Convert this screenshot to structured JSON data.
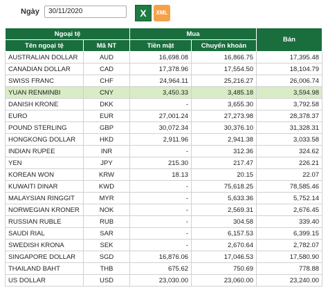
{
  "filter": {
    "date_label": "Ngày",
    "date_value": "30/11/2020",
    "excel_label": "X",
    "xml_label": "XML"
  },
  "table": {
    "group_headers": {
      "currency": "Ngoại tệ",
      "buy": "Mua",
      "sell": "Bán"
    },
    "sub_headers": {
      "name": "Tên ngoại tệ",
      "code": "Mã NT",
      "cash": "Tiền mặt",
      "transfer": "Chuyển khoản"
    },
    "rows": [
      {
        "name": "AUSTRALIAN DOLLAR",
        "code": "AUD",
        "cash": "16,698.08",
        "transfer": "16,866.75",
        "sell": "17,395.48"
      },
      {
        "name": "CANADIAN DOLLAR",
        "code": "CAD",
        "cash": "17,378.96",
        "transfer": "17,554.50",
        "sell": "18,104.79"
      },
      {
        "name": "SWISS FRANC",
        "code": "CHF",
        "cash": "24,964.11",
        "transfer": "25,216.27",
        "sell": "26,006.74"
      },
      {
        "name": "YUAN RENMINBI",
        "code": "CNY",
        "cash": "3,450.33",
        "transfer": "3,485.18",
        "sell": "3,594.98"
      },
      {
        "name": "DANISH KRONE",
        "code": "DKK",
        "cash": "-",
        "transfer": "3,655.30",
        "sell": "3,792.58"
      },
      {
        "name": "EURO",
        "code": "EUR",
        "cash": "27,001.24",
        "transfer": "27,273.98",
        "sell": "28,378.37"
      },
      {
        "name": "POUND STERLING",
        "code": "GBP",
        "cash": "30,072.34",
        "transfer": "30,376.10",
        "sell": "31,328.31"
      },
      {
        "name": "HONGKONG DOLLAR",
        "code": "HKD",
        "cash": "2,911.96",
        "transfer": "2,941.38",
        "sell": "3,033.58"
      },
      {
        "name": "INDIAN RUPEE",
        "code": "INR",
        "cash": "-",
        "transfer": "312.36",
        "sell": "324.62"
      },
      {
        "name": "YEN",
        "code": "JPY",
        "cash": "215.30",
        "transfer": "217.47",
        "sell": "226.21"
      },
      {
        "name": "KOREAN WON",
        "code": "KRW",
        "cash": "18.13",
        "transfer": "20.15",
        "sell": "22.07"
      },
      {
        "name": "KUWAITI DINAR",
        "code": "KWD",
        "cash": "-",
        "transfer": "75,618.25",
        "sell": "78,585.46"
      },
      {
        "name": "MALAYSIAN RINGGIT",
        "code": "MYR",
        "cash": "-",
        "transfer": "5,633.36",
        "sell": "5,752.14"
      },
      {
        "name": "NORWEGIAN KRONER",
        "code": "NOK",
        "cash": "-",
        "transfer": "2,569.31",
        "sell": "2,676.45"
      },
      {
        "name": "RUSSIAN RUBLE",
        "code": "RUB",
        "cash": "-",
        "transfer": "304.58",
        "sell": "339.40"
      },
      {
        "name": "SAUDI RIAL",
        "code": "SAR",
        "cash": "-",
        "transfer": "6,157.53",
        "sell": "6,399.15"
      },
      {
        "name": "SWEDISH KRONA",
        "code": "SEK",
        "cash": "-",
        "transfer": "2,670.64",
        "sell": "2,782.07"
      },
      {
        "name": "SINGAPORE DOLLAR",
        "code": "SGD",
        "cash": "16,876.06",
        "transfer": "17,046.53",
        "sell": "17,580.90"
      },
      {
        "name": "THAILAND BAHT",
        "code": "THB",
        "cash": "675.62",
        "transfer": "750.69",
        "sell": "778.88"
      },
      {
        "name": "US DOLLAR",
        "code": "USD",
        "cash": "23,030.00",
        "transfer": "23,060.00",
        "sell": "23,240.00"
      }
    ],
    "highlighted_code": "CNY"
  }
}
